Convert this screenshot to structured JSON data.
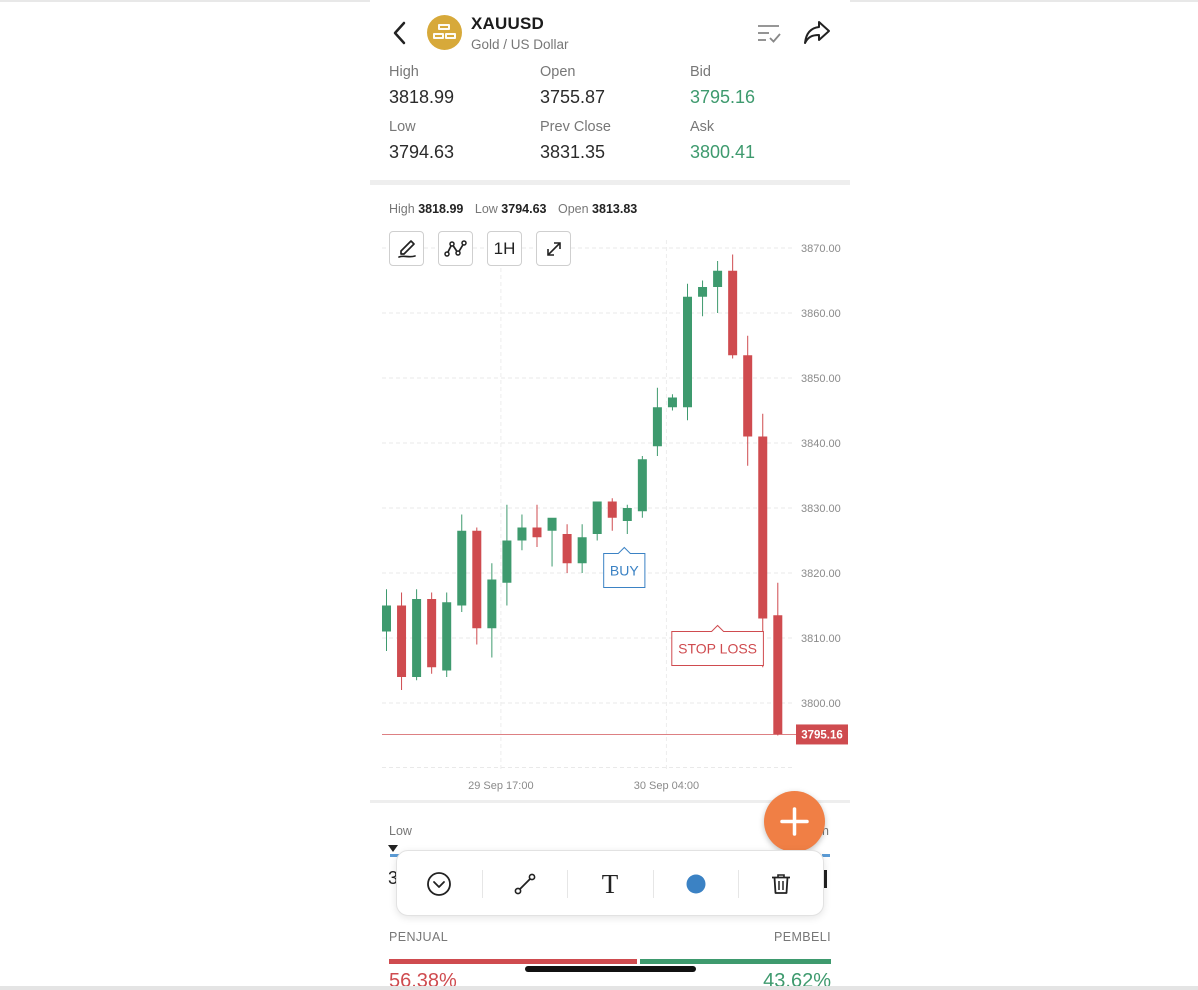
{
  "header": {
    "symbol": "XAUUSD",
    "name": "Gold / US Dollar"
  },
  "stats": {
    "high_label": "High",
    "high_value": "3818.99",
    "open_label": "Open",
    "open_value": "3755.87",
    "bid_label": "Bid",
    "bid_value": "3795.16",
    "low_label": "Low",
    "low_value": "3794.63",
    "prev_close_label": "Prev Close",
    "prev_close_value": "3831.35",
    "ask_label": "Ask",
    "ask_value": "3800.41"
  },
  "chart_header": {
    "high_label": "High",
    "high_value": "3818.99",
    "low_label": "Low",
    "low_value": "3794.63",
    "open_label": "Open",
    "open_value": "3813.83"
  },
  "chart_tools": {
    "draw_icon": "brush-icon",
    "indicator_icon": "line-chart-icon",
    "timeframe": "1H",
    "expand_icon": "expand-icon"
  },
  "chart_data": {
    "type": "candlestick",
    "y_ticks": [
      "3870.00",
      "3860.00",
      "3850.00",
      "3840.00",
      "3830.00",
      "3820.00",
      "3810.00",
      "3800.00"
    ],
    "y_range": [
      3790,
      3873
    ],
    "x_ticks": [
      {
        "label": "29 Sep 17:00",
        "index": 7.6
      },
      {
        "label": "30 Sep 04:00",
        "index": 18.6
      }
    ],
    "last_price": "3795.16",
    "last_price_value": 3795.16,
    "up_color": "#3e9a6e",
    "down_color": "#cf4b4f",
    "candles": [
      {
        "o": 3811.0,
        "h": 3817.5,
        "l": 3808.0,
        "c": 3815.0
      },
      {
        "o": 3815.0,
        "h": 3817.0,
        "l": 3802.0,
        "c": 3804.0
      },
      {
        "o": 3804.0,
        "h": 3817.5,
        "l": 3803.5,
        "c": 3816.0
      },
      {
        "o": 3816.0,
        "h": 3817.0,
        "l": 3804.5,
        "c": 3805.5
      },
      {
        "o": 3805.0,
        "h": 3817.0,
        "l": 3804.0,
        "c": 3815.5
      },
      {
        "o": 3815.0,
        "h": 3829.0,
        "l": 3814.0,
        "c": 3826.5
      },
      {
        "o": 3826.5,
        "h": 3827.0,
        "l": 3809.0,
        "c": 3811.5
      },
      {
        "o": 3811.5,
        "h": 3821.5,
        "l": 3807.0,
        "c": 3819.0
      },
      {
        "o": 3818.5,
        "h": 3830.5,
        "l": 3815.0,
        "c": 3825.0
      },
      {
        "o": 3825.0,
        "h": 3829.0,
        "l": 3823.5,
        "c": 3827.0
      },
      {
        "o": 3827.0,
        "h": 3830.5,
        "l": 3824.0,
        "c": 3825.5
      },
      {
        "o": 3826.5,
        "h": 3828.0,
        "l": 3821.0,
        "c": 3828.5
      },
      {
        "o": 3826.0,
        "h": 3827.5,
        "l": 3820.0,
        "c": 3821.5
      },
      {
        "o": 3821.5,
        "h": 3827.5,
        "l": 3820.0,
        "c": 3825.5
      },
      {
        "o": 3826.0,
        "h": 3831.0,
        "l": 3825.0,
        "c": 3831.0
      },
      {
        "o": 3831.0,
        "h": 3831.5,
        "l": 3826.5,
        "c": 3828.5
      },
      {
        "o": 3828.0,
        "h": 3830.5,
        "l": 3826.0,
        "c": 3830.0
      },
      {
        "o": 3829.5,
        "h": 3838.0,
        "l": 3828.5,
        "c": 3837.5
      },
      {
        "o": 3839.5,
        "h": 3848.5,
        "l": 3838.0,
        "c": 3845.5
      },
      {
        "o": 3845.5,
        "h": 3847.5,
        "l": 3845.0,
        "c": 3847.0
      },
      {
        "o": 3845.5,
        "h": 3864.5,
        "l": 3843.5,
        "c": 3862.5
      },
      {
        "o": 3862.5,
        "h": 3865.0,
        "l": 3859.5,
        "c": 3864.0
      },
      {
        "o": 3864.0,
        "h": 3868.0,
        "l": 3860.0,
        "c": 3866.5
      },
      {
        "o": 3866.5,
        "h": 3869.0,
        "l": 3853.0,
        "c": 3853.5
      },
      {
        "o": 3853.5,
        "h": 3856.5,
        "l": 3836.5,
        "c": 3841.0
      },
      {
        "o": 3841.0,
        "h": 3844.5,
        "l": 3805.5,
        "c": 3813.0
      },
      {
        "o": 3813.5,
        "h": 3818.5,
        "l": 3795.0,
        "c": 3795.2
      }
    ],
    "annotations": [
      {
        "text": "BUY",
        "index": 15.8,
        "price": 3823.0,
        "color": "#3b82c4",
        "pointer": "up"
      },
      {
        "text": "STOP LOSS",
        "index": 22.0,
        "price": 3811.0,
        "color": "#cf4b4f",
        "pointer": "up"
      }
    ]
  },
  "drawing_toolbar": {
    "items": [
      "chevron-circle-icon",
      "trendline-icon",
      "text-tool-icon",
      "color-dot-icon",
      "trash-icon"
    ],
    "text_glyph": "T",
    "color_dot": "#3b82c4"
  },
  "sentiment": {
    "range_low_label": "Low",
    "range_high_label": "h",
    "low_value_peek": "3",
    "sellers_label": "PENJUAL",
    "buyers_label": "PEMBELI",
    "sellers_pct": "56.38%",
    "buyers_pct": "43.62%",
    "sellers_fraction": 0.5638
  }
}
